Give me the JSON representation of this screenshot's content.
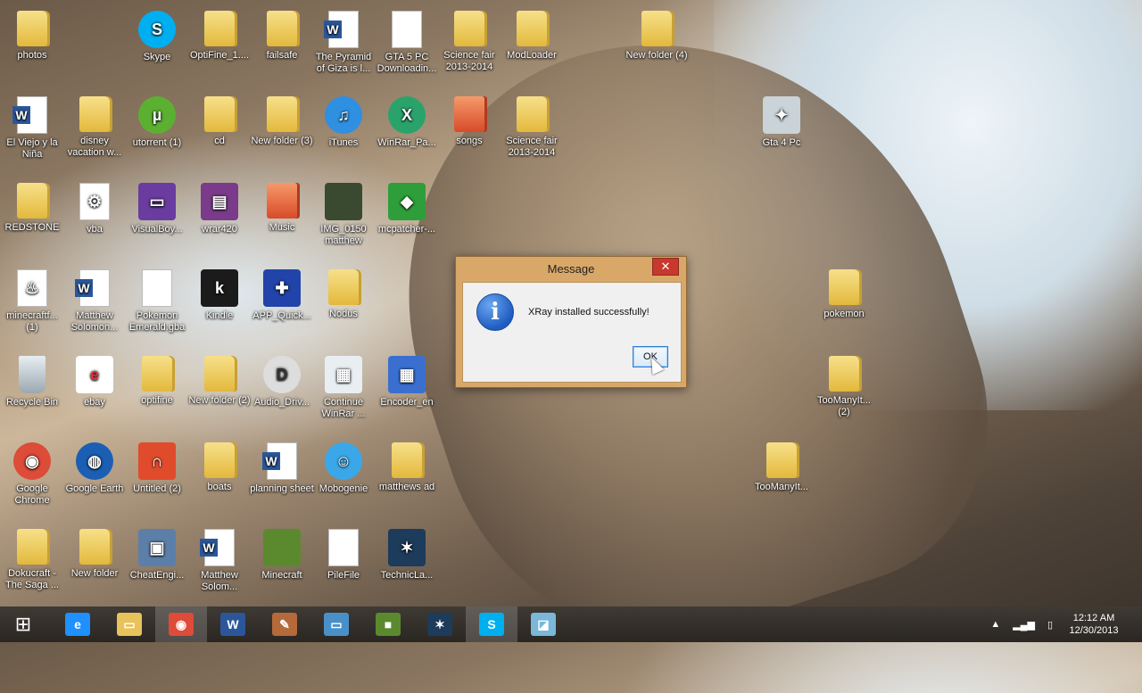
{
  "desktop_icons": [
    {
      "label": "photos",
      "kind": "folder",
      "x": 0
    },
    {
      "label": "Skype",
      "kind": "skype"
    },
    {
      "label": "OptiFine_1....",
      "kind": "folder"
    },
    {
      "label": "failsafe",
      "kind": "folder"
    },
    {
      "label": "The Pyramid of Giza is l...",
      "kind": "word"
    },
    {
      "label": "GTA 5 PC Downloadin...",
      "kind": "doc"
    },
    {
      "label": "Science fair 2013-2014",
      "kind": "folder"
    },
    {
      "label": "ModLoader",
      "kind": "folder"
    },
    {
      "label": "New folder (4)",
      "kind": "folder"
    },
    {
      "label": "El Viejo y la Niña",
      "kind": "word"
    },
    {
      "label": "disney vacation w...",
      "kind": "folder"
    },
    {
      "label": "utorrent (1)",
      "kind": "utorrent"
    },
    {
      "label": "cd",
      "kind": "folder"
    },
    {
      "label": "New folder (3)",
      "kind": "folder"
    },
    {
      "label": "iTunes",
      "kind": "itunes"
    },
    {
      "label": "WinRar_Pa...",
      "kind": "winrarpa"
    },
    {
      "label": "songs",
      "kind": "folder-red"
    },
    {
      "label": "Science fair 2013-2014",
      "kind": "folder"
    },
    {
      "label": "Gta 4 Pc",
      "kind": "gta"
    },
    {
      "label": "REDSTONE",
      "kind": "folder"
    },
    {
      "label": "vba",
      "kind": "vba"
    },
    {
      "label": "VisualBoy...",
      "kind": "visualboy"
    },
    {
      "label": "wrar420",
      "kind": "winrar"
    },
    {
      "label": "Music",
      "kind": "folder-red"
    },
    {
      "label": "IMG_0150 matthew",
      "kind": "photo"
    },
    {
      "label": "mcpatcher-...",
      "kind": "mcpatcher"
    },
    {
      "label": "minecraftf... (1)",
      "kind": "java"
    },
    {
      "label": "Matthew Solomon...",
      "kind": "word"
    },
    {
      "label": "Pokemon Emerald.gba",
      "kind": "doc"
    },
    {
      "label": "Kindle",
      "kind": "kindle"
    },
    {
      "label": "APP_Quick...",
      "kind": "app"
    },
    {
      "label": "Nodus",
      "kind": "folder"
    },
    {
      "label": "pokemon",
      "kind": "folder"
    },
    {
      "label": "Recycle Bin",
      "kind": "recycle"
    },
    {
      "label": "ebay",
      "kind": "ebay"
    },
    {
      "label": "optifine",
      "kind": "folder"
    },
    {
      "label": "New folder (2)",
      "kind": "folder"
    },
    {
      "label": "Audio_Driv...",
      "kind": "dell"
    },
    {
      "label": "Continue WinRar ...",
      "kind": "continue"
    },
    {
      "label": "Encoder_en",
      "kind": "encoder"
    },
    {
      "label": "TooManyIt... (2)",
      "kind": "folder"
    },
    {
      "label": "Google Chrome",
      "kind": "chrome"
    },
    {
      "label": "Google Earth",
      "kind": "earth"
    },
    {
      "label": "Untitled (2)",
      "kind": "untitled"
    },
    {
      "label": "boats",
      "kind": "folder"
    },
    {
      "label": "planning sheet",
      "kind": "word"
    },
    {
      "label": "Mobogenie",
      "kind": "mobogenie"
    },
    {
      "label": "matthews ad",
      "kind": "folder"
    },
    {
      "label": "TooManyIt...",
      "kind": "folder"
    },
    {
      "label": "Dokucraft - The Saga ...",
      "kind": "folder"
    },
    {
      "label": "New folder",
      "kind": "folder"
    },
    {
      "label": "CheatEngi...",
      "kind": "cheat"
    },
    {
      "label": "Matthew Solom...",
      "kind": "word"
    },
    {
      "label": "Minecraft",
      "kind": "minecraft"
    },
    {
      "label": "PileFile",
      "kind": "doc"
    },
    {
      "label": "TechnicLa...",
      "kind": "technic"
    }
  ],
  "dialog": {
    "title": "Message",
    "close_label": "✕",
    "info_glyph": "i",
    "message": "XRay installed successfully!",
    "ok_label": "OK"
  },
  "taskbar": {
    "start_glyph": "⊞",
    "items": [
      {
        "name": "internet-explorer",
        "glyph": "e",
        "color": "#1e90ff"
      },
      {
        "name": "file-explorer",
        "glyph": "▭",
        "color": "#e8c25a"
      },
      {
        "name": "chrome",
        "glyph": "◉",
        "color": "#dd4b39",
        "active": true
      },
      {
        "name": "word",
        "glyph": "W",
        "color": "#2b579a"
      },
      {
        "name": "winrar-tool",
        "glyph": "✎",
        "color": "#b46a3a"
      },
      {
        "name": "monitor",
        "glyph": "▭",
        "color": "#4a90c8"
      },
      {
        "name": "minecraft",
        "glyph": "■",
        "color": "#5b8a2e"
      },
      {
        "name": "technic",
        "glyph": "✶",
        "color": "#1d3b5a"
      },
      {
        "name": "skype",
        "glyph": "S",
        "color": "#00aff0",
        "active": true
      },
      {
        "name": "window-app",
        "glyph": "◪",
        "color": "#7ab7d8"
      }
    ],
    "tray_up": "▲",
    "tray_signal": "▂▄▆",
    "tray_battery": "▯",
    "time": "12:12 AM",
    "date": "12/30/2013"
  }
}
